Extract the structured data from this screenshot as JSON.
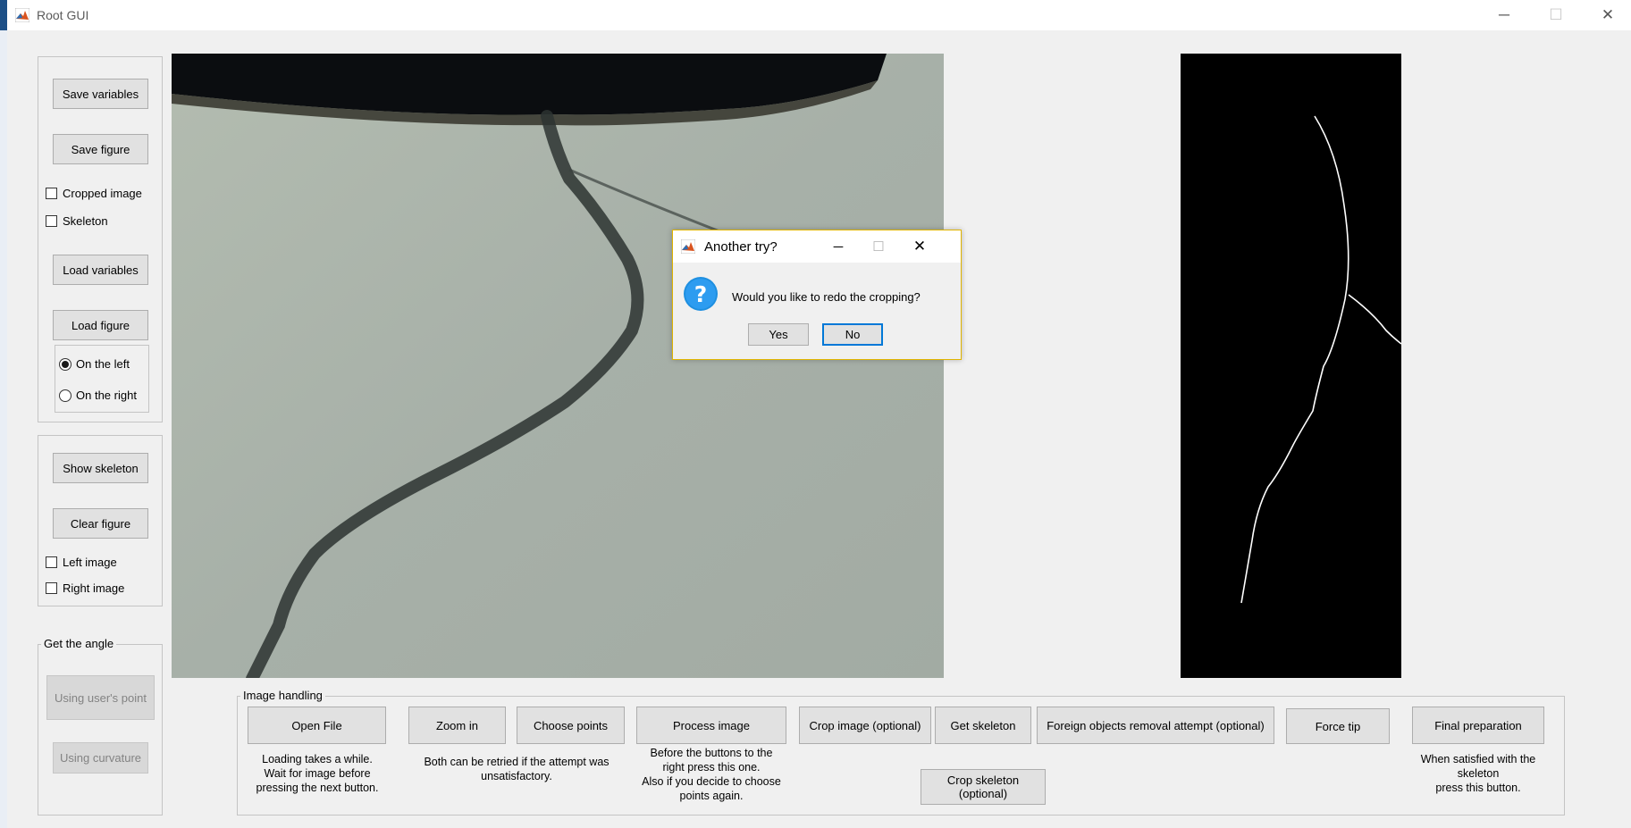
{
  "window": {
    "title": "Root GUI",
    "minimize": "─",
    "maximize": "☐",
    "close": "✕"
  },
  "sidebar": {
    "save_variables": "Save variables",
    "save_figure": "Save figure",
    "cropped_image": "Cropped image",
    "skeleton": "Skeleton",
    "load_variables": "Load variables",
    "load_figure": "Load figure",
    "on_the_left": "On the left",
    "on_the_right": "On the right",
    "show_skeleton": "Show skeleton",
    "clear_figure": "Clear figure",
    "left_image": "Left image",
    "right_image": "Right image",
    "angle_group": "Get the angle",
    "using_users_point": "Using user's point",
    "using_curvature": "Using curvature"
  },
  "image_handling": {
    "group_label": "Image handling",
    "open_file": "Open File",
    "open_file_note": "Loading takes a while.\nWait for  image before\npressing the next button.",
    "zoom_in": "Zoom in",
    "choose_points": "Choose points",
    "retry_note": "Both can be retried if the attempt was\nunsatisfactory.",
    "process_image": "Process image",
    "process_note": "Before the buttons to the\nright press this one.\nAlso if you decide to choose\npoints again.",
    "crop_image": "Crop image (optional)",
    "get_skeleton": "Get skeleton",
    "foreign_objects": "Foreign objects removal attempt (optional)",
    "force_tip": "Force tip",
    "final_preparation": "Final preparation",
    "final_note": "When satisfied with the\nskeleton\npress this button.",
    "crop_skeleton": "Crop skeleton (optional)"
  },
  "dialog": {
    "title": "Another try?",
    "message": "Would you like to redo the cropping?",
    "yes": "Yes",
    "no": "No"
  },
  "state": {
    "cropped_image_checked": false,
    "skeleton_checked": false,
    "selected_side": "On the left",
    "left_image_checked": false,
    "right_image_checked": false
  },
  "colors": {
    "window_bg": "#f0f0f0",
    "dialog_border": "#e0b400",
    "question_icon": "#1e8fe0",
    "skeleton_bg": "#000000"
  },
  "icons": [
    "matlab-icon",
    "question-icon",
    "minimize-icon",
    "maximize-icon",
    "close-icon"
  ]
}
